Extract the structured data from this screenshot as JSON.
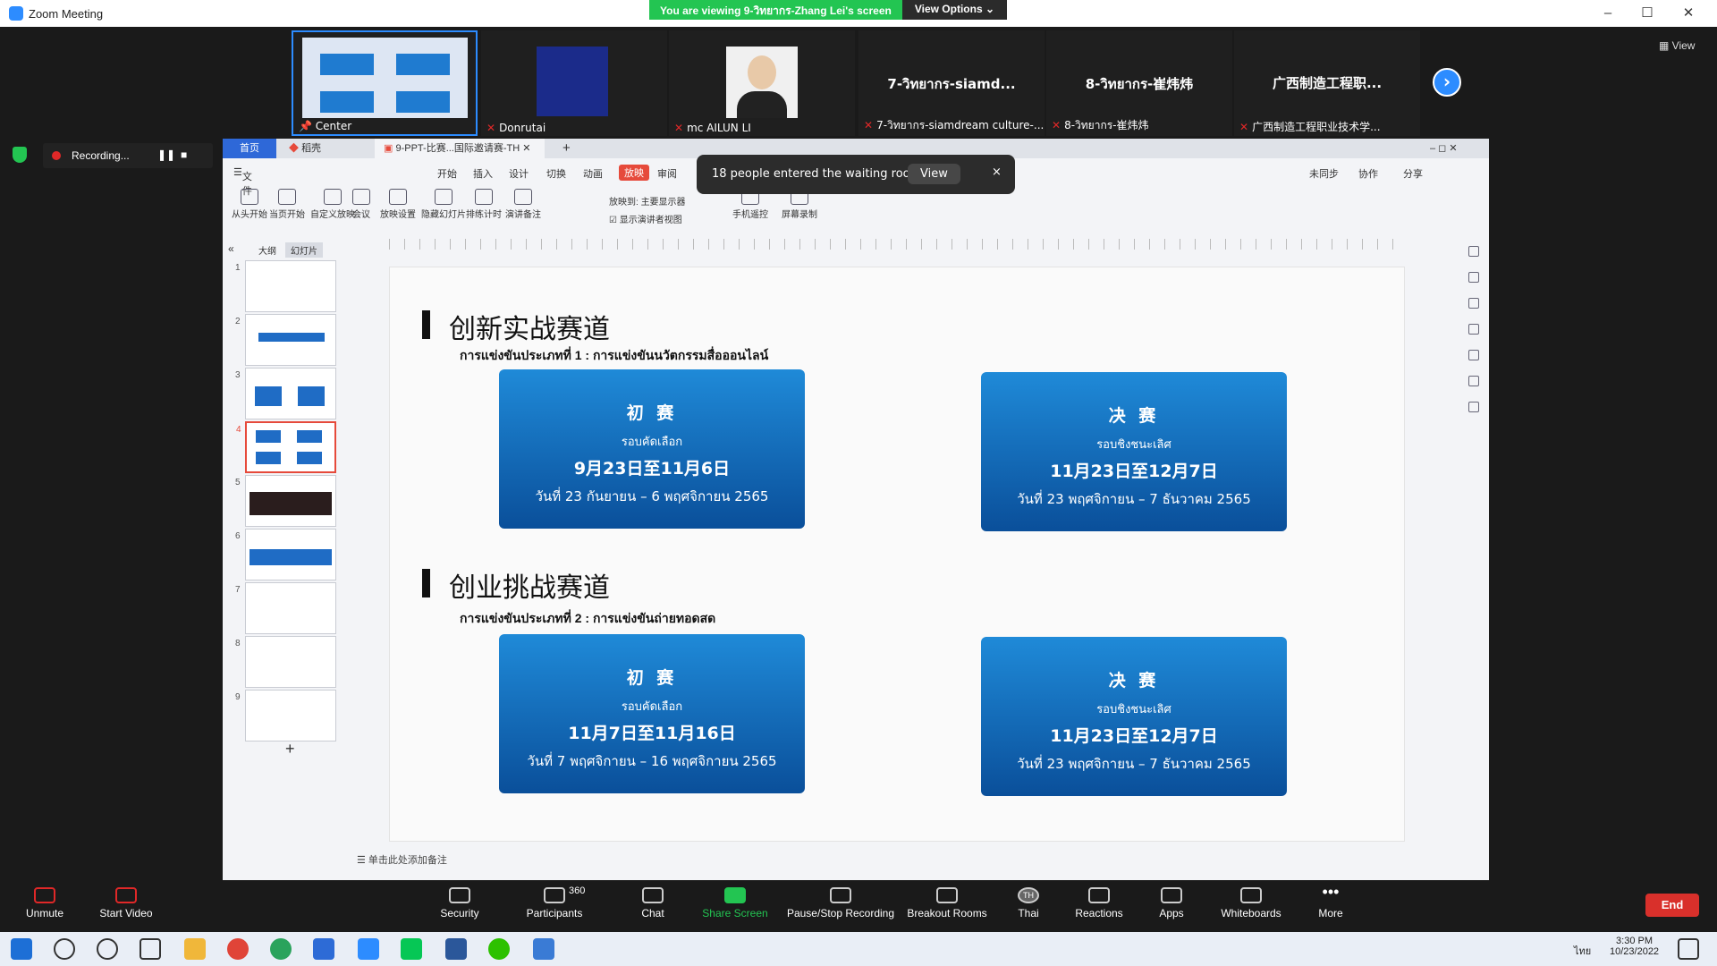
{
  "window": {
    "title": "Zoom Meeting"
  },
  "viewing": {
    "message": "You are viewing 9-วิทยากร-Zhang Lei's screen",
    "options": "View Options ⌄"
  },
  "gallery": {
    "view": "View",
    "tiles": [
      {
        "name": "Center",
        "big": ""
      },
      {
        "name": "Donrutai",
        "big": ""
      },
      {
        "name": "mc AILUN LI",
        "big": ""
      },
      {
        "name": "7-วิทยากร-siamdream culture-...",
        "big": "7-วิทยากร-siamd..."
      },
      {
        "name": "8-วิทยากร-崔炜炜",
        "big": "8-วิทยากร-崔炜炜"
      },
      {
        "name": "广西制造工程职业技术学...",
        "big": "广西制造工程职..."
      }
    ]
  },
  "recording": {
    "label": "Recording..."
  },
  "notice": {
    "text": "18 people entered the waiting room",
    "view": "View",
    "close": "×"
  },
  "wps": {
    "tabs": {
      "home": "首页",
      "shell": "稻壳",
      "doc": "9-PPT-比赛...国际邀请赛-TH",
      "new": "+"
    },
    "menu": {
      "file": "文件",
      "start": "开始",
      "insert": "插入",
      "design": "设计",
      "switch": "切换",
      "anim": "动画",
      "show": "放映",
      "review": "审阅",
      "sync": "未同步",
      "coop": "协作",
      "share": "分享"
    },
    "ribbon": {
      "from_start": "从头开始",
      "from_current": "当页开始",
      "custom": "自定义放映",
      "meeting": "会议",
      "settings": "放映设置",
      "hide": "隐藏幻灯片",
      "timing": "排练计时",
      "notes": "演讲备注",
      "show_to": "放映到:",
      "monitor": "主要显示器",
      "presenter": "显示演讲者视图",
      "phone": "手机遥控",
      "record": "屏幕录制"
    },
    "side": {
      "outline": "大纲",
      "slides": "幻灯片",
      "add": "+",
      "thumbs": [
        "1",
        "2",
        "3",
        "4",
        "5",
        "6",
        "7",
        "8",
        "9"
      ]
    },
    "notes": "单击此处添加备注"
  },
  "slide": {
    "sec1_title": "创新实战赛道",
    "sec1_sub": "การแข่งขันประเภทที่ 1 : การแข่งขันนวัตกรรมสื่อออนไลน์",
    "sec2_title": "创业挑战赛道",
    "sec2_sub": "การแข่งขันประเภทที่ 2 : การแข่งขันถ่ายทอดสด",
    "cards": [
      {
        "a": "初 赛",
        "b": "รอบคัดเลือก",
        "c": "9月23日至11月6日",
        "d": "วันที่ 23 กันยายน – 6 พฤศจิกายน 2565"
      },
      {
        "a": "决 赛",
        "b": "รอบชิงชนะเลิศ",
        "c": "11月23日至12月7日",
        "d": "วันที่ 23 พฤศจิกายน – 7 ธันวาคม 2565"
      },
      {
        "a": "初 赛",
        "b": "รอบคัดเลือก",
        "c": "11月7日至11月16日",
        "d": "วันที่ 7 พฤศจิกายน – 16 พฤศจิกายน 2565"
      },
      {
        "a": "决 赛",
        "b": "รอบชิงชนะเลิศ",
        "c": "11月23日至12月7日",
        "d": "วันที่ 23 พฤศจิกายน – 7 ธันวาคม 2565"
      }
    ]
  },
  "controls": {
    "unmute": "Unmute",
    "video": "Start Video",
    "security": "Security",
    "participants": "Participants",
    "count": "360",
    "chat": "Chat",
    "share": "Share Screen",
    "pause": "Pause/Stop Recording",
    "breakout": "Breakout Rooms",
    "thai": "Thai",
    "reactions": "Reactions",
    "apps": "Apps",
    "whiteboards": "Whiteboards",
    "more": "More",
    "end": "End",
    "lang_badge": "TH"
  },
  "clock": {
    "time": "3:30 PM",
    "date": "10/23/2022",
    "lang": "ไทย"
  }
}
